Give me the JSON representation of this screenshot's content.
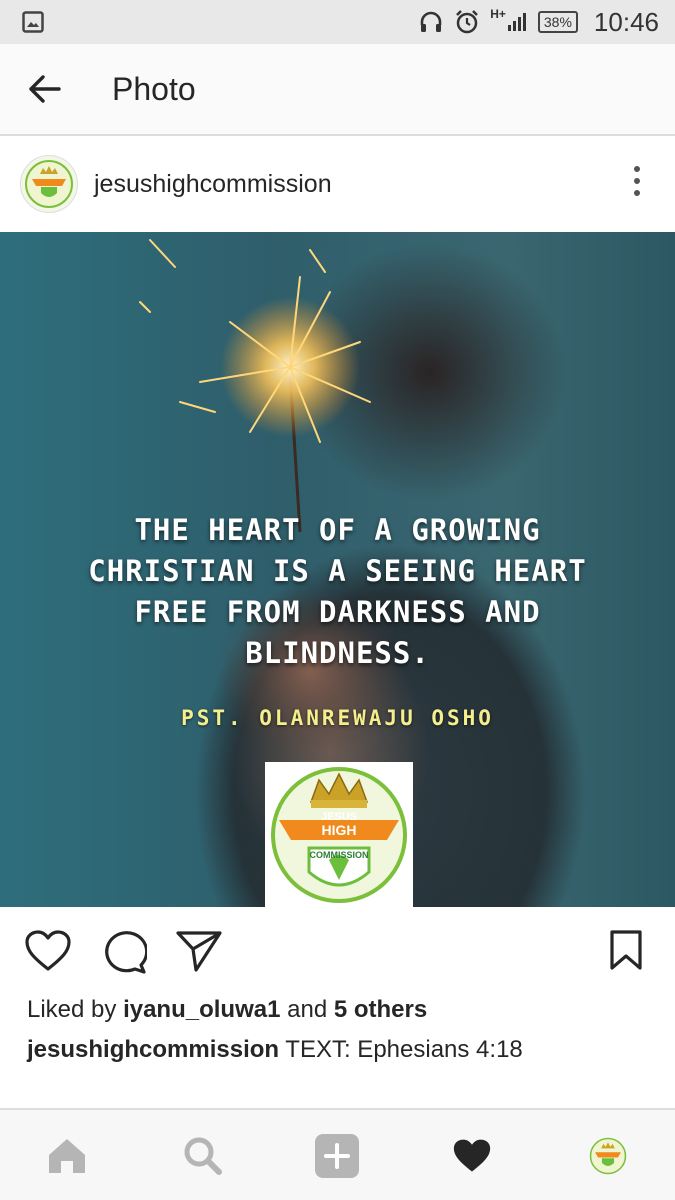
{
  "status_bar": {
    "network": "H+",
    "battery": "38%",
    "time": "10:46"
  },
  "app_bar": {
    "title": "Photo"
  },
  "post": {
    "username": "jesushighcommission",
    "image_quote": "THE HEART OF A GROWING\nCHRISTIAN IS A SEEING HEART\nFREE FROM DARKNESS AND\nBLINDNESS.",
    "image_author": "PST. OLANREWAJU OSHO",
    "logo_text": {
      "line1": "JESUS",
      "line2": "HIGH",
      "line3": "COMMISSION"
    },
    "likes": {
      "prefix": "Liked by ",
      "user": "iyanu_oluwa1",
      "middle": " and ",
      "others": "5 others"
    },
    "caption": {
      "user": "jesushighcommission",
      "text": " TEXT: Ephesians 4:18"
    }
  },
  "icons": {
    "status": [
      "gallery-icon",
      "headphones-icon",
      "alarm-icon",
      "signal-icon",
      "battery-icon"
    ],
    "actions": [
      "heart-icon",
      "comment-icon",
      "share-icon",
      "bookmark-icon"
    ],
    "nav": [
      "home-icon",
      "search-icon",
      "add-icon",
      "activity-heart-icon",
      "profile-avatar"
    ]
  },
  "colors": {
    "status_bar_bg": "#e8e8e8",
    "app_bar_bg": "#fafafa",
    "text": "#262626",
    "author_text": "#f4ee8c",
    "nav_icon_inactive": "#b5b5b5"
  }
}
